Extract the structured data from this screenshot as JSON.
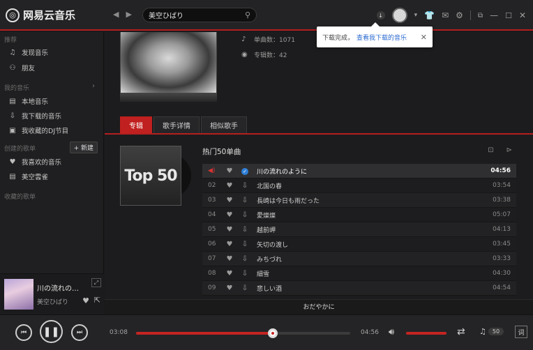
{
  "app": {
    "logo_text": "网易云音乐",
    "search_value": "美空ひばり"
  },
  "toast": {
    "message": "下载完成，",
    "link": "查看我下载的音乐",
    "close": "✕"
  },
  "sidebar": {
    "section_recommend": "推荐",
    "items_recommend": [
      {
        "icon": "music-note-icon",
        "glyph": "♫",
        "label": "发现音乐"
      },
      {
        "icon": "friends-icon",
        "glyph": "⚇",
        "label": "朋友"
      }
    ],
    "section_my_music": "我的音乐",
    "items_my_music": [
      {
        "icon": "local-music-icon",
        "glyph": "▤",
        "label": "本地音乐"
      },
      {
        "icon": "download-icon",
        "glyph": "⇩",
        "label": "我下载的音乐"
      },
      {
        "icon": "radio-icon",
        "glyph": "▣",
        "label": "我收藏的DJ节目"
      }
    ],
    "section_created": "创建的歌单",
    "new_button": "+ 新建",
    "items_created": [
      {
        "icon": "heart-icon",
        "glyph": "♥",
        "label": "我喜欢的音乐"
      },
      {
        "icon": "playlist-icon",
        "glyph": "▤",
        "label": "美空雲雀"
      }
    ],
    "section_collected": "收藏的歌单"
  },
  "mini_player": {
    "title": "川の流れの…",
    "artist": "美空ひばり"
  },
  "artist": {
    "song_count_label": "单曲数：",
    "song_count": "1071",
    "album_count_label": "专辑数：",
    "album_count": "42"
  },
  "tabs": [
    {
      "label": "专辑",
      "active": true
    },
    {
      "label": "歌手详情",
      "active": false
    },
    {
      "label": "相似歌手",
      "active": false
    }
  ],
  "album": {
    "cover_text": "Top 50",
    "list_title": "热门50单曲"
  },
  "tracks": [
    {
      "num": "",
      "name": "川の流れのように",
      "duration": "04:56",
      "playing": true
    },
    {
      "num": "02",
      "name": "北国の春",
      "duration": "03:54",
      "playing": false
    },
    {
      "num": "03",
      "name": "長崎は今日も雨だった",
      "duration": "03:38",
      "playing": false
    },
    {
      "num": "04",
      "name": "愛燦燦",
      "duration": "05:07",
      "playing": false
    },
    {
      "num": "05",
      "name": "越前岬",
      "duration": "04:13",
      "playing": false
    },
    {
      "num": "06",
      "name": "矢切の渡し",
      "duration": "03:45",
      "playing": false
    },
    {
      "num": "07",
      "name": "みちづれ",
      "duration": "03:33",
      "playing": false
    },
    {
      "num": "08",
      "name": "細雪",
      "duration": "04:30",
      "playing": false
    },
    {
      "num": "09",
      "name": "悲しい酒",
      "duration": "04:54",
      "playing": false
    }
  ],
  "more_bar_text": "おだやかに",
  "player": {
    "elapsed": "03:08",
    "total": "04:56",
    "progress": 0.64,
    "volume": 1.0,
    "playlist_count": "50",
    "lyric_label": "词"
  },
  "colors": {
    "accent": "#c42422",
    "link": "#2b6bd1"
  }
}
